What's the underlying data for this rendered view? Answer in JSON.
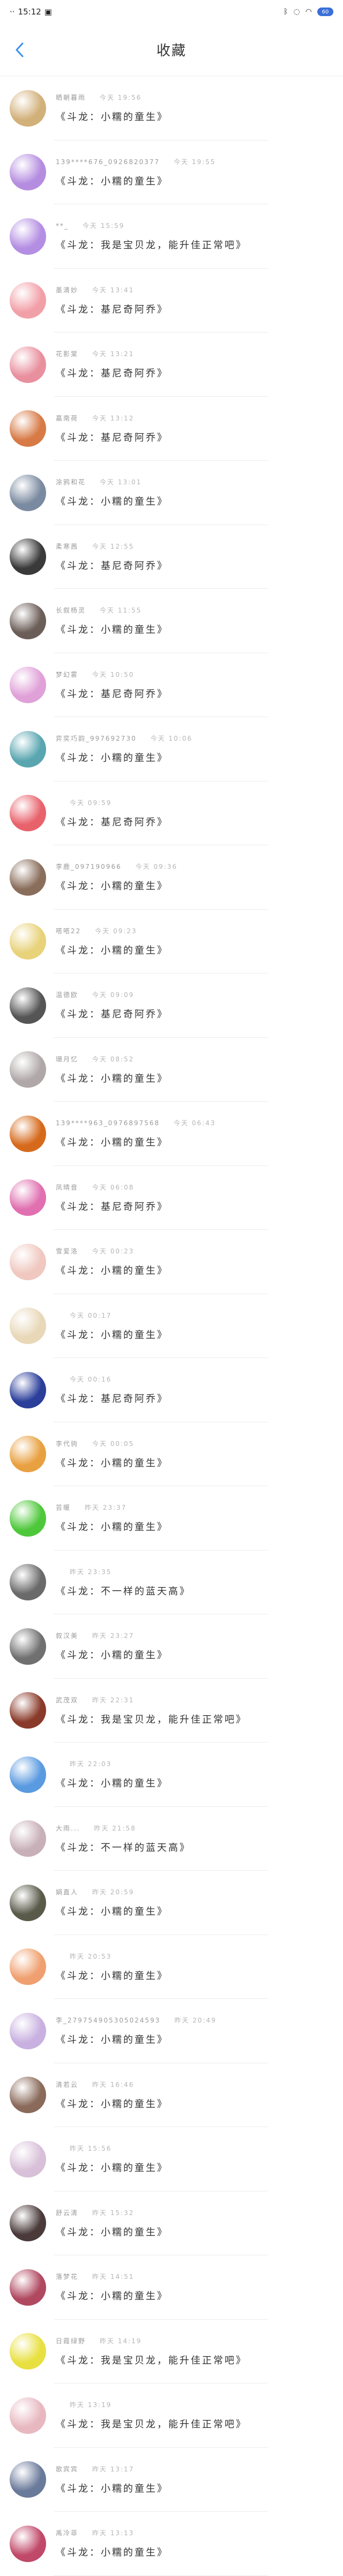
{
  "status": {
    "time": "15:12",
    "right_text": "·",
    "battery": "60"
  },
  "header": {
    "title": "收藏"
  },
  "colors": {
    "accent": "#3a8ff2"
  },
  "items": [
    {
      "name": "晒朝暮雨",
      "time": "今天 19:56",
      "content": "《斗龙：小糯的童生》",
      "color": "#d2b07a"
    },
    {
      "name": "139****676_0926820377",
      "time": "今天 19:55",
      "content": "《斗龙：小糯的童生》",
      "color": "#b58de0"
    },
    {
      "name": "**_",
      "time": "今天 15:59",
      "content": "《斗龙：我是宝贝龙，能升佳正常吧》",
      "color": "#b48ee3"
    },
    {
      "name": "墨清妙",
      "time": "今天 13:41",
      "content": "《斗龙：基尼奇阿乔》",
      "color": "#f2a0a8"
    },
    {
      "name": "花影棠",
      "time": "今天 13:21",
      "content": "《斗龙：基尼奇阿乔》",
      "color": "#e9909e"
    },
    {
      "name": "嘉南荷",
      "time": "今天 13:12",
      "content": "《斗龙：基尼奇阿乔》",
      "color": "#d77a45"
    },
    {
      "name": "涂鸦和花",
      "time": "今天 13:01",
      "content": "《斗龙：小糯的童生》",
      "color": "#7a8aa0"
    },
    {
      "name": "柔寒茜",
      "time": "今天 12:55",
      "content": "《斗龙：基尼奇阿乔》",
      "color": "#3a3a3a"
    },
    {
      "name": "长叙杨灵",
      "time": "今天 11:55",
      "content": "《斗龙：小糯的童生》",
      "color": "#6b5d57"
    },
    {
      "name": "梦幻雾",
      "time": "今天 10:50",
      "content": "《斗龙：基尼奇阿乔》",
      "color": "#e0a0d8"
    },
    {
      "name": "弈奕巧韵_997692730",
      "time": "今天 10:06",
      "content": "《斗龙：小糯的童生》",
      "color": "#5aa6b0"
    },
    {
      "name": "",
      "time": "今天 09:59",
      "content": "《斗龙：基尼奇阿乔》",
      "color": "#e8626c"
    },
    {
      "name": "李鹿_097190966",
      "time": "今天 09:36",
      "content": "《斗龙：小糯的童生》",
      "color": "#8a6e5c"
    },
    {
      "name": "嗒嗒22",
      "time": "今天 09:23",
      "content": "《斗龙：小糯的童生》",
      "color": "#e8d27a"
    },
    {
      "name": "温德欧",
      "time": "今天 09:09",
      "content": "《斗龙：基尼奇阿乔》",
      "color": "#555555"
    },
    {
      "name": "珊月忆",
      "time": "今天 08:52",
      "content": "《斗龙：小糯的童生》",
      "color": "#b0a8a8"
    },
    {
      "name": "139****963_0976897568",
      "time": "今天 06:43",
      "content": "《斗龙：小糯的童生》",
      "color": "#d66a1c"
    },
    {
      "name": "凤晴音",
      "time": "今天 06:08",
      "content": "《斗龙：基尼奇阿乔》",
      "color": "#e070b0"
    },
    {
      "name": "雪爱洛",
      "time": "今天 00:23",
      "content": "《斗龙：小糯的童生》",
      "color": "#f0c8c0"
    },
    {
      "name": "",
      "time": "今天 00:17",
      "content": "《斗龙：小糯的童生》",
      "color": "#e8d8b8"
    },
    {
      "name": "",
      "time": "今天 00:16",
      "content": "《斗龙：基尼奇阿乔》",
      "color": "#2a3e9a"
    },
    {
      "name": "李代驹",
      "time": "今天 00:05",
      "content": "《斗龙：小糯的童生》",
      "color": "#e8a040"
    },
    {
      "name": "芸暖",
      "time": "昨天 23:37",
      "content": "《斗龙：小糯的童生》",
      "color": "#4ec83a"
    },
    {
      "name": "",
      "time": "昨天 23:35",
      "content": "《斗龙：不一样的蓝天高》",
      "color": "#6a6a6a"
    },
    {
      "name": "叙汉美",
      "time": "昨天 23:27",
      "content": "《斗龙：小糯的童生》",
      "color": "#707070"
    },
    {
      "name": "武茂双",
      "time": "昨天 22:31",
      "content": "《斗龙：我是宝贝龙，能升佳正常吧》",
      "color": "#8a3a2a"
    },
    {
      "name": "",
      "time": "昨天 22:03",
      "content": "《斗龙：小糯的童生》",
      "color": "#5a9ae0"
    },
    {
      "name": "大雨...",
      "time": "昨天 21:58",
      "content": "《斗龙：不一样的蓝天高》",
      "color": "#c8b0b8"
    },
    {
      "name": "娟直人",
      "time": "昨天 20:59",
      "content": "《斗龙：小糯的童生》",
      "color": "#5a5a4a"
    },
    {
      "name": "",
      "time": "昨天 20:53",
      "content": "《斗龙：小糯的童生》",
      "color": "#f0a070"
    },
    {
      "name": "李_279754905305024593",
      "time": "昨天 20:49",
      "content": "《斗龙：小糯的童生》",
      "color": "#c8b0e0"
    },
    {
      "name": "清若云",
      "time": "昨天 16:46",
      "content": "《斗龙：小糯的童生》",
      "color": "#8a6a5a"
    },
    {
      "name": "",
      "time": "昨天 15:56",
      "content": "《斗龙：小糯的童生》",
      "color": "#d8c0d8"
    },
    {
      "name": "舒云清",
      "time": "昨天 15:32",
      "content": "《斗龙：小糯的童生》",
      "color": "#4a3a3a"
    },
    {
      "name": "落梦花",
      "time": "昨天 14:51",
      "content": "《斗龙：小糯的童生》",
      "color": "#b04860"
    },
    {
      "name": "日霞绿野",
      "time": "昨天 14:19",
      "content": "《斗龙：我是宝贝龙，能升佳正常吧》",
      "color": "#e8e040"
    },
    {
      "name": "",
      "time": "昨天 13:19",
      "content": "《斗龙：我是宝贝龙，能升佳正常吧》",
      "color": "#e8b8c0"
    },
    {
      "name": "歌宾宾",
      "time": "昨天 13:17",
      "content": "《斗龙：小糯的童生》",
      "color": "#6a7a9a"
    },
    {
      "name": "禹冷菲",
      "time": "昨天 13:13",
      "content": "《斗龙：小糯的童生》",
      "color": "#c04868"
    }
  ]
}
